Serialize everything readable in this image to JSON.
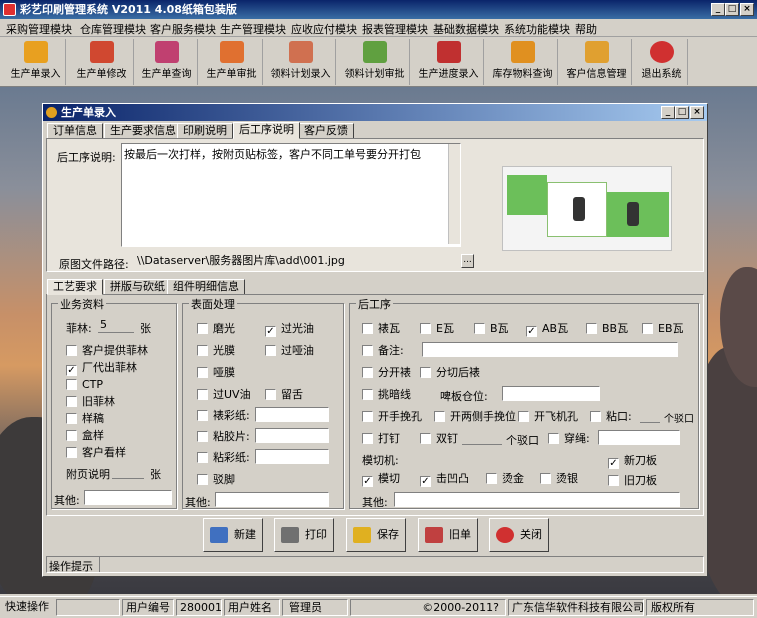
{
  "app": {
    "title": "彩艺印刷管理系统  V2011 4.08纸箱包装版"
  },
  "menu": [
    "采购管理模块",
    "仓库管理模块",
    "客户服务模块",
    "生产管理模块",
    "应收应付模块",
    "报表管理模块",
    "基础数据模块",
    "系统功能模块",
    "帮助"
  ],
  "toolbar": [
    {
      "label": "生产单录入",
      "icon": "box-add-icon",
      "color": "#e8a020"
    },
    {
      "label": "生产单修改",
      "icon": "box-edit-icon",
      "color": "#d04830"
    },
    {
      "label": "生产单查询",
      "icon": "box-search-icon",
      "color": "#c04070"
    },
    {
      "label": "生产单审批",
      "icon": "box-approve-icon",
      "color": "#e07030"
    },
    {
      "label": "领料计划录入",
      "icon": "material-add-icon",
      "color": "#d07050"
    },
    {
      "label": "领料计划审批",
      "icon": "material-approve-icon",
      "color": "#60a040"
    },
    {
      "label": "生产进度录入",
      "icon": "progress-icon",
      "color": "#c03030"
    },
    {
      "label": "库存物料查询",
      "icon": "inventory-icon",
      "color": "#e09020"
    },
    {
      "label": "客户信息管理",
      "icon": "customer-icon",
      "color": "#e0a030"
    },
    {
      "label": "退出系统",
      "icon": "exit-icon",
      "color": "#d03030"
    }
  ],
  "dialog": {
    "title": "生产单录入",
    "tabs": [
      "订单信息",
      "生产要求信息",
      "印刷说明",
      "后工序说明",
      "客户反馈"
    ],
    "active_tab": "后工序说明",
    "post_process_label": "后工序说明:",
    "post_process_text": "按最后一次打样，按附页贴标签，客户不同工单号要分开打包",
    "image_path_label": "原图文件路径:",
    "image_path": "\\\\Dataserver\\服务器图片库\\add\\001.jpg",
    "browse": "..."
  },
  "subtabs": [
    "工艺要求",
    "拼版与砍纸",
    "组件明细信息"
  ],
  "business": {
    "title": "业务资料",
    "film_label": "菲林:",
    "film_value": "5",
    "film_unit": "张",
    "checks": [
      {
        "label": "客户提供菲林",
        "checked": false
      },
      {
        "label": "厂代出菲林",
        "checked": true
      },
      {
        "label": "CTP",
        "checked": false
      },
      {
        "label": "旧菲林",
        "checked": false
      },
      {
        "label": "样稿",
        "checked": false
      },
      {
        "label": "盒样",
        "checked": false
      },
      {
        "label": "客户看样",
        "checked": false
      }
    ],
    "attach_label": "附页说明",
    "attach_unit": "张",
    "other_label": "其他:"
  },
  "surface": {
    "title": "表面处理",
    "checks": [
      {
        "label": "磨光",
        "checked": false
      },
      {
        "label": "过光油",
        "checked": true
      },
      {
        "label": "光膜",
        "checked": false
      },
      {
        "label": "过哑油",
        "checked": false
      },
      {
        "label": "哑膜",
        "checked": false
      },
      {
        "label": "过UV油",
        "checked": false
      },
      {
        "label": "留舌",
        "checked": false
      },
      {
        "label": "裱彩纸:",
        "checked": false
      },
      {
        "label": "粘胶片:",
        "checked": false
      },
      {
        "label": "粘彩纸:",
        "checked": false
      },
      {
        "label": "驳脚",
        "checked": false
      }
    ],
    "other_label": "其他:"
  },
  "post": {
    "title": "后工序",
    "row1": [
      {
        "label": "裱瓦",
        "checked": false
      },
      {
        "label": "E瓦",
        "checked": false
      },
      {
        "label": "B瓦",
        "checked": false
      },
      {
        "label": "AB瓦",
        "checked": true
      },
      {
        "label": "BB瓦",
        "checked": false
      },
      {
        "label": "EB瓦",
        "checked": false
      }
    ],
    "remark": "备注:",
    "split_pack": "分开裱",
    "split_after": "分切后裱",
    "crease": "挑暗线",
    "beer_label": "啤板仓位:",
    "row5": [
      {
        "label": "开手挽孔",
        "checked": false
      },
      {
        "label": "开两侧手挽位",
        "checked": false
      },
      {
        "label": "开飞机孔",
        "checked": false
      },
      {
        "label": "粘口:",
        "checked": false
      }
    ],
    "notch_unit": "个驳口",
    "row6": [
      {
        "label": "打钉",
        "checked": false
      },
      {
        "label": "双钉",
        "checked": false
      },
      {
        "label": "穿绳:",
        "checked": false
      }
    ],
    "notch_unit2": "个驳口",
    "die_label": "模切机:",
    "new_die": {
      "label": "新刀板",
      "checked": true
    },
    "old_die": {
      "label": "旧刀板",
      "checked": false
    },
    "row8": [
      {
        "label": "模切",
        "checked": true
      },
      {
        "label": "击凹凸",
        "checked": true
      },
      {
        "label": "烫金",
        "checked": false
      },
      {
        "label": "烫银",
        "checked": false
      }
    ],
    "other_label": "其他:"
  },
  "buttons": [
    {
      "label": "新建",
      "icon": "new-doc-icon",
      "color": "#4070c0"
    },
    {
      "label": "打印",
      "icon": "printer-icon",
      "color": "#707070"
    },
    {
      "label": "保存",
      "icon": "save-icon",
      "color": "#e0b020"
    },
    {
      "label": "旧单",
      "icon": "old-order-icon",
      "color": "#c04040"
    },
    {
      "label": "关闭",
      "icon": "close-icon",
      "color": "#d03030"
    }
  ],
  "hint_label": "操作提示",
  "status": {
    "quick": "快速操作",
    "user_no_label": "用户编号",
    "user_no": "280001",
    "user_name_label": "用户姓名",
    "user_name": "管理员",
    "copyright": "©2000-2011?",
    "company": "广东信华软件科技有限公司",
    "rights": "版权所有"
  }
}
